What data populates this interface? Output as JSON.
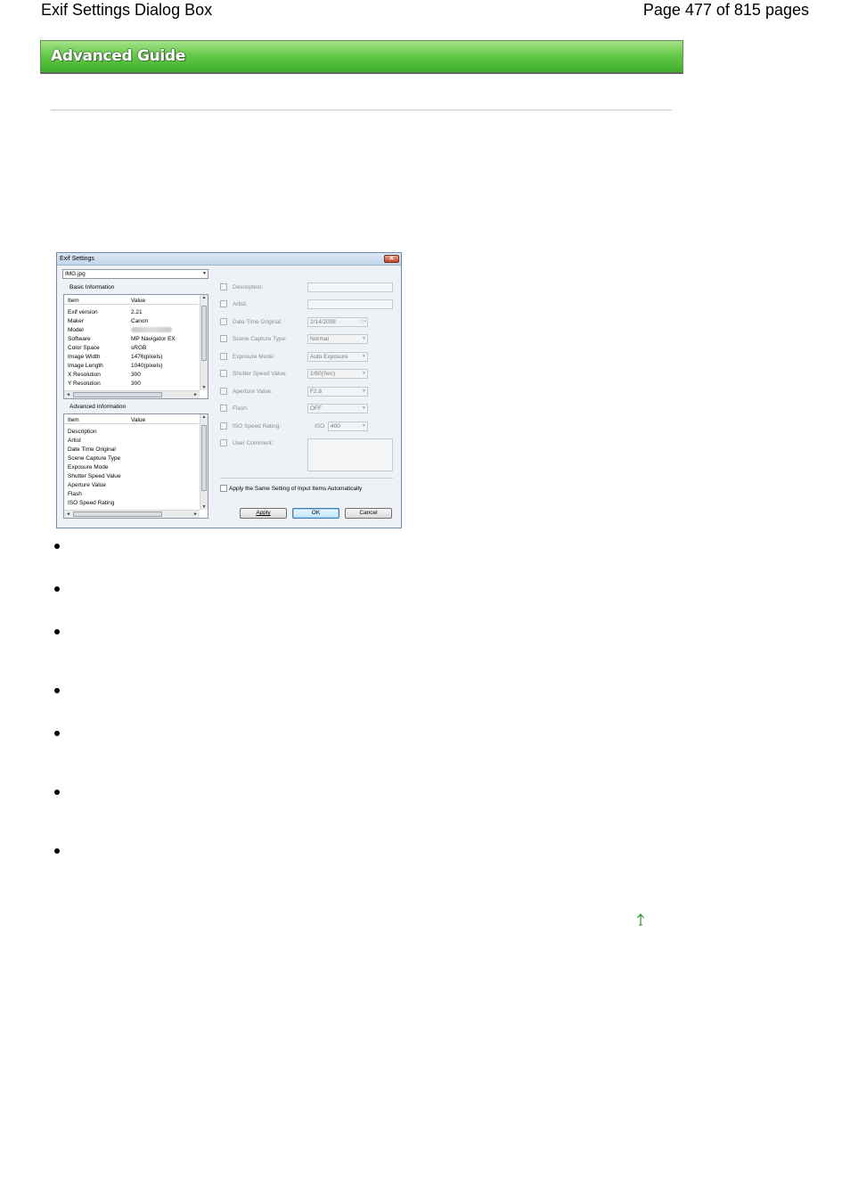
{
  "header": {
    "title": "Exif Settings Dialog Box",
    "page": "Page 477 of 815 pages"
  },
  "banner": {
    "label": "Advanced Guide"
  },
  "dialog": {
    "title": "Exif Settings",
    "close_glyph": "✕",
    "file_combo": "IMG.jpg",
    "basic": {
      "group_label": "Basic Information",
      "col_item": "Item",
      "col_value": "Value",
      "rows": [
        {
          "item": "Exif version",
          "value": "2.21"
        },
        {
          "item": "Maker",
          "value": "Canon"
        },
        {
          "item": "Model",
          "value": ""
        },
        {
          "item": "Software",
          "value": "MP Navigator EX"
        },
        {
          "item": "Color Space",
          "value": "sRGB"
        },
        {
          "item": "Image Width",
          "value": "1476(pixels)"
        },
        {
          "item": "Image Length",
          "value": "1040(pixels)"
        },
        {
          "item": "X Resolution",
          "value": "300"
        },
        {
          "item": "Y Resolution",
          "value": "300"
        }
      ]
    },
    "advanced": {
      "group_label": "Advanced Information",
      "col_item": "Item",
      "col_value": "Value",
      "rows": [
        {
          "item": "Description"
        },
        {
          "item": "Artist"
        },
        {
          "item": "Date Time Original"
        },
        {
          "item": "Scene Capture Type"
        },
        {
          "item": "Exposure Mode"
        },
        {
          "item": "Shutter Speed Value"
        },
        {
          "item": "Aperture Value"
        },
        {
          "item": "Flash"
        },
        {
          "item": "ISO Speed Rating"
        }
      ]
    },
    "fields": {
      "description": "Description:",
      "artist": "Artist:",
      "date_time_original": "Date Time Original:",
      "date_value": "2/14/2008",
      "scene_capture_type": "Scene Capture Type:",
      "scene_value": "Normal",
      "exposure_mode": "Exposure Mode:",
      "exposure_value": "Auto Exposure",
      "shutter_speed": "Shutter Speed Value:",
      "shutter_value": "1/60(Sec)",
      "aperture": "Aperture Value:",
      "aperture_value": "F2.8",
      "flash": "Flash:",
      "flash_value": "OFF",
      "iso_speed": "ISO Speed Rating:",
      "iso_label": "ISO",
      "iso_value": "400",
      "user_comment": "User Comment:"
    },
    "apply_all_label": "Apply the Same Setting of Input Items Automatically",
    "buttons": {
      "apply": "Apply",
      "ok": "OK",
      "cancel": "Cancel"
    }
  }
}
